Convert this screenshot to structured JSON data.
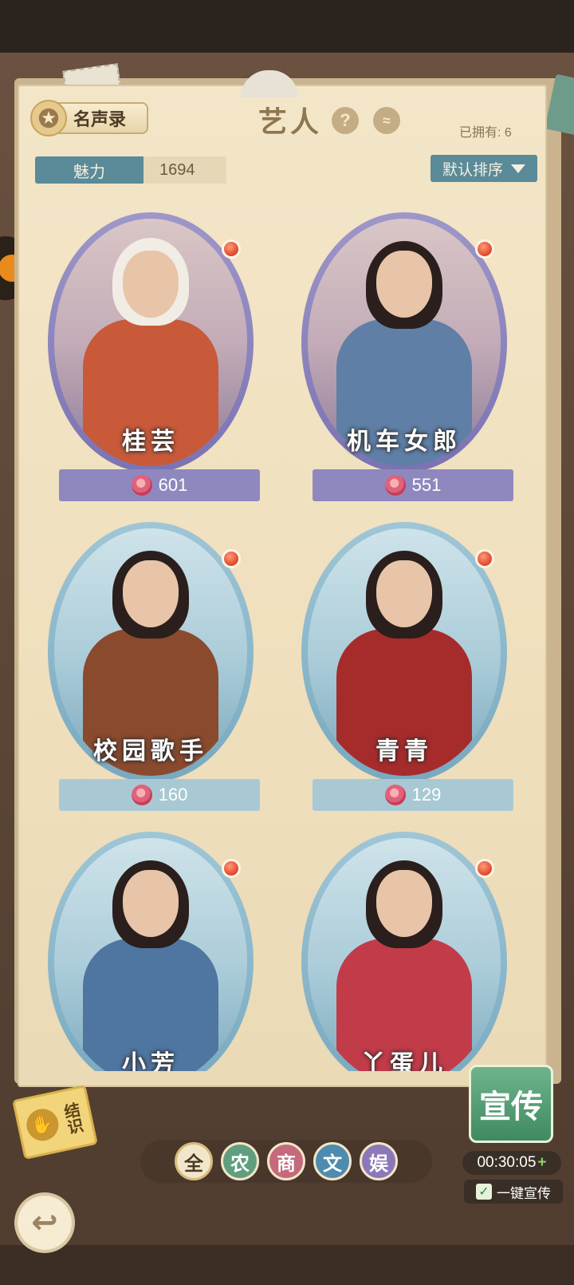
{
  "header": {
    "fame_button_label": "名声录",
    "title": "艺人",
    "help_glyph": "?",
    "collapse_glyph": "≈",
    "owned_text": "已拥有: 6"
  },
  "stats": {
    "charm_label": "魅力",
    "charm_value": "1694",
    "sort_label": "默认排序"
  },
  "artists": [
    {
      "name": "桂芸",
      "roses": "601",
      "frame": "purple"
    },
    {
      "name": "机车女郎",
      "roses": "551",
      "frame": "purple"
    },
    {
      "name": "校园歌手",
      "roses": "160",
      "frame": "blue"
    },
    {
      "name": "青青",
      "roses": "129",
      "frame": "blue"
    },
    {
      "name": "小芳",
      "roses": "",
      "frame": "blue"
    },
    {
      "name": "丫蛋儿",
      "roses": "",
      "frame": "blue"
    }
  ],
  "bottom": {
    "deal_label": "结识",
    "filters": [
      "全",
      "农",
      "商",
      "文",
      "娱"
    ],
    "promote_label": "宣传",
    "timer": "00:30:05",
    "timer_plus": "+",
    "auto_promote_label": "一键宣传",
    "auto_promote_check": "✓",
    "back_glyph": "↩"
  },
  "colors": {
    "purple_frame": "#8f88bf",
    "blue_frame": "#a8c9d3",
    "accent_teal": "#5b8a98",
    "promote_green": "#3f8a62"
  },
  "icons": [
    "star-badge-icon",
    "help-icon",
    "collapse-icon",
    "sort-arrow-icon",
    "rose-icon",
    "handshake-icon",
    "back-arrow-icon",
    "checkbox-icon"
  ]
}
